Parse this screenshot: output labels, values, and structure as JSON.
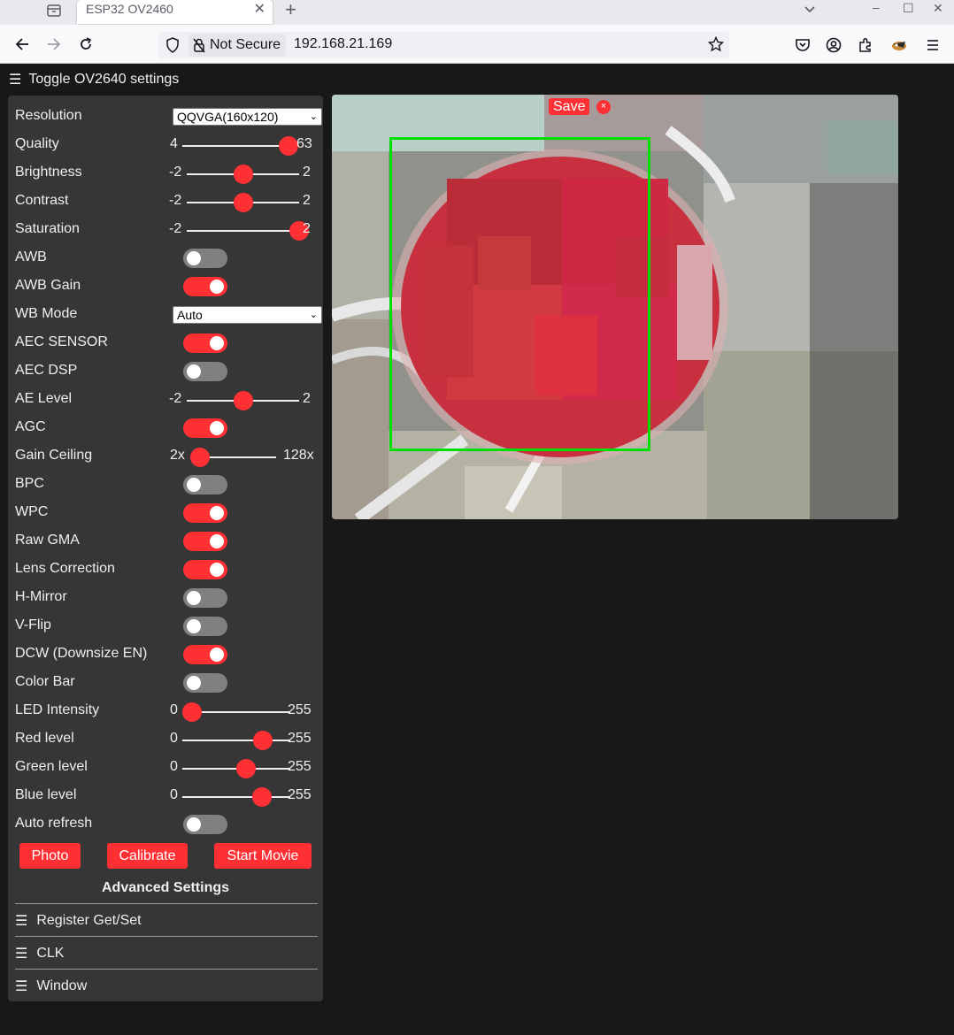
{
  "browser": {
    "tab_title": "ESP32 OV2460",
    "not_secure_label": "Not Secure",
    "url": "192.168.21.169",
    "tab_close_glyph": "✕",
    "new_tab_glyph": "+",
    "window_controls": [
      "⌄",
      "–",
      "☐",
      "✕"
    ]
  },
  "page": {
    "toggle_settings_label": "Toggle OV2640 settings",
    "hamburger_glyph": "☰"
  },
  "settings": {
    "resolution": {
      "label": "Resolution",
      "value": "QQVGA(160x120)"
    },
    "quality": {
      "label": "Quality",
      "min": "4",
      "max": "63",
      "value": 63,
      "range": [
        4,
        63
      ]
    },
    "brightness": {
      "label": "Brightness",
      "min": "-2",
      "max": "2",
      "value": 0,
      "range": [
        -2,
        2
      ]
    },
    "contrast": {
      "label": "Contrast",
      "min": "-2",
      "max": "2",
      "value": 0,
      "range": [
        -2,
        2
      ]
    },
    "saturation": {
      "label": "Saturation",
      "min": "-2",
      "max": "2",
      "value": 2,
      "range": [
        -2,
        2
      ]
    },
    "awb": {
      "label": "AWB",
      "on": false
    },
    "awb_gain": {
      "label": "AWB Gain",
      "on": true
    },
    "wb_mode": {
      "label": "WB Mode",
      "value": "Auto"
    },
    "aec_sensor": {
      "label": "AEC SENSOR",
      "on": true
    },
    "aec_dsp": {
      "label": "AEC DSP",
      "on": false
    },
    "ae_level": {
      "label": "AE Level",
      "min": "-2",
      "max": "2",
      "value": 0,
      "range": [
        -2,
        2
      ]
    },
    "agc": {
      "label": "AGC",
      "on": true
    },
    "gain_ceiling": {
      "label": "Gain Ceiling",
      "min": "2x",
      "max": "128x",
      "value": 0,
      "range": [
        0,
        6
      ]
    },
    "bpc": {
      "label": "BPC",
      "on": false
    },
    "wpc": {
      "label": "WPC",
      "on": true
    },
    "raw_gma": {
      "label": "Raw GMA",
      "on": true
    },
    "lens_correction": {
      "label": "Lens Correction",
      "on": true
    },
    "h_mirror": {
      "label": "H-Mirror",
      "on": false
    },
    "v_flip": {
      "label": "V-Flip",
      "on": false
    },
    "dcw": {
      "label": "DCW (Downsize EN)",
      "on": true
    },
    "color_bar": {
      "label": "Color Bar",
      "on": false
    },
    "led_intensity": {
      "label": "LED Intensity",
      "min": "0",
      "max": "255",
      "value": 0,
      "range": [
        0,
        255
      ]
    },
    "red_level": {
      "label": "Red level",
      "min": "0",
      "max": "255",
      "value": 190,
      "range": [
        0,
        255
      ]
    },
    "green_level": {
      "label": "Green level",
      "min": "0",
      "max": "255",
      "value": 151,
      "range": [
        0,
        255
      ]
    },
    "blue_level": {
      "label": "Blue level",
      "min": "0",
      "max": "255",
      "value": 188,
      "range": [
        0,
        255
      ]
    },
    "auto_refresh": {
      "label": "Auto refresh",
      "on": false
    }
  },
  "buttons": {
    "photo": "Photo",
    "calibrate": "Calibrate",
    "start_movie": "Start Movie"
  },
  "advanced": {
    "title": "Advanced Settings",
    "sections": [
      "Register Get/Set",
      "CLK",
      "Window"
    ]
  },
  "stream": {
    "save_label": "Save",
    "close_glyph": "×"
  },
  "colors": {
    "accent": "#ff3034",
    "panel": "#363636",
    "background": "#181818",
    "switch_off": "#808080",
    "detection_box": "#00e000"
  }
}
